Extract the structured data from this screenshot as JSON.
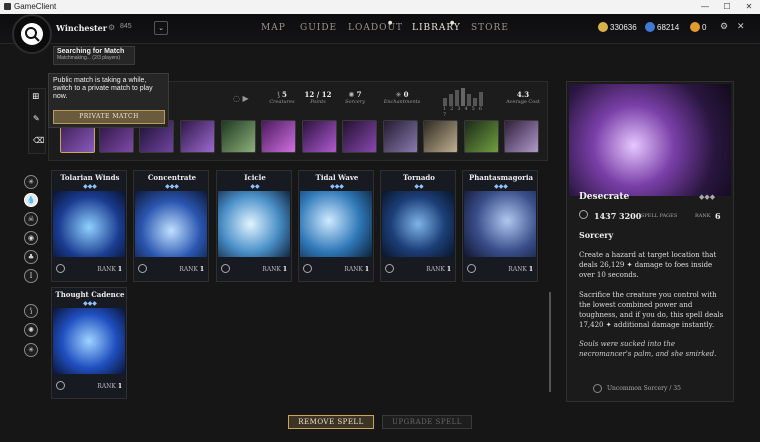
{
  "window": {
    "title": "GameClient",
    "minimize": "—",
    "maximize": "☐",
    "close": "✕"
  },
  "player": {
    "name": "Winchester",
    "level": "845"
  },
  "nav": {
    "map": "MAP",
    "guide": "GUIDE",
    "loadout": "LOADOUT",
    "library": "LIBRARY",
    "store": "STORE",
    "badge": "●"
  },
  "currency": {
    "gold": "330636",
    "gems": "68214",
    "tokens": "0"
  },
  "search": {
    "title": "Searching for Match",
    "status": "Matchmaking... (2/3 players)"
  },
  "tooltip": {
    "message": "Public match is taking a while, switch to a private match to play now.",
    "button": "PRIVATE MATCH"
  },
  "deck_stats": {
    "creatures_value": "5",
    "creatures_label": "Creatures",
    "points_value": "12 / 12",
    "points_label": "Points",
    "sorcery_value": "7",
    "sorcery_label": "Sorcery",
    "enchant_value": "0",
    "enchant_label": "Enchantments",
    "curve_labels": "1 2 3 4 5 6 7",
    "avg_value": "4.3",
    "avg_label": "Average Cost"
  },
  "cards": [
    {
      "name": "Tolarian Winds",
      "pips": "◆◆◆",
      "rank_label": "RANK",
      "rank": "1"
    },
    {
      "name": "Concentrate",
      "pips": "◆◆◆",
      "rank_label": "RANK",
      "rank": "1"
    },
    {
      "name": "Icicle",
      "pips": "◆◆",
      "rank_label": "RANK",
      "rank": "1"
    },
    {
      "name": "Tidal Wave",
      "pips": "◆◆◆",
      "rank_label": "RANK",
      "rank": "1"
    },
    {
      "name": "Tornado",
      "pips": "◆◆",
      "rank_label": "RANK",
      "rank": "1"
    },
    {
      "name": "Phantasmagoria",
      "pips": "◆◆◆",
      "rank_label": "RANK",
      "rank": "1"
    },
    {
      "name": "Thought Cadence",
      "pips": "◆◆◆",
      "rank_label": "RANK",
      "rank": "1"
    }
  ],
  "buttons": {
    "remove": "REMOVE SPELL",
    "upgrade": "UPGRADE SPELL"
  },
  "detail": {
    "name": "Desecrate",
    "pips": "◆◆◆",
    "pages_current": "1437",
    "pages_total": "3200",
    "pages_label": "SPELL PAGES",
    "rank_label": "RANK",
    "rank": "6",
    "type": "Sorcery",
    "desc1": "Create a hazard at target location that deals 26,129 ✦ damage to foes inside over 10 seconds.",
    "desc2": "Sacrifice the creature you control with the lowest combined power and toughness, and if you do, this spell deals 17,420 ✦ additional damage instantly.",
    "flavor": "Souls were sucked into the necromancer's palm, and she smirked.",
    "footer": "Uncommon Sorcery / 35"
  },
  "colors": {
    "gold": "#c9a75a",
    "blue": "#8fc1ff",
    "bg": "#161617"
  }
}
